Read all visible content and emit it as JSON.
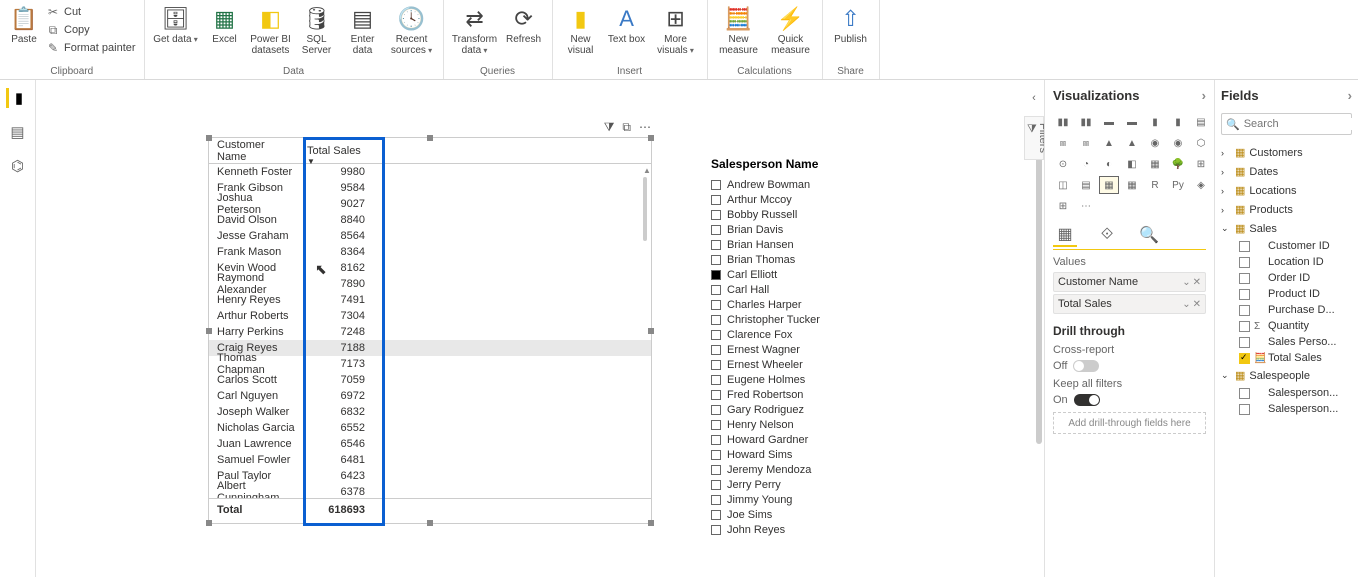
{
  "ribbon": {
    "paste": "Paste",
    "cut": "Cut",
    "copy": "Copy",
    "format_painter": "Format painter",
    "clipboard": "Clipboard",
    "get_data": "Get data",
    "excel": "Excel",
    "pbi_ds": "Power BI datasets",
    "sql": "SQL Server",
    "enter": "Enter data",
    "recent": "Recent sources",
    "data_group": "Data",
    "transform": "Transform data",
    "refresh": "Refresh",
    "queries": "Queries",
    "new_visual": "New visual",
    "text_box": "Text box",
    "more_visuals": "More visuals",
    "insert": "Insert",
    "new_measure": "New measure",
    "quick_measure": "Quick measure",
    "calculations": "Calculations",
    "publish": "Publish",
    "share": "Share"
  },
  "filters_label": "Filters",
  "chart_data": {
    "type": "table",
    "columns": [
      "Customer Name",
      "Total Sales"
    ],
    "rows": [
      [
        "Kenneth Foster",
        9980
      ],
      [
        "Frank Gibson",
        9584
      ],
      [
        "Joshua Peterson",
        9027
      ],
      [
        "David Olson",
        8840
      ],
      [
        "Jesse Graham",
        8564
      ],
      [
        "Frank Mason",
        8364
      ],
      [
        "Kevin Wood",
        8162
      ],
      [
        "Raymond Alexander",
        7890
      ],
      [
        "Henry Reyes",
        7491
      ],
      [
        "Arthur Roberts",
        7304
      ],
      [
        "Harry Perkins",
        7248
      ],
      [
        "Craig Reyes",
        7188
      ],
      [
        "Thomas Chapman",
        7173
      ],
      [
        "Carlos Scott",
        7059
      ],
      [
        "Carl Nguyen",
        6972
      ],
      [
        "Joseph Walker",
        6832
      ],
      [
        "Nicholas Garcia",
        6552
      ],
      [
        "Juan Lawrence",
        6546
      ],
      [
        "Samuel Fowler",
        6481
      ],
      [
        "Paul Taylor",
        6423
      ],
      [
        "Albert Cunningham",
        6378
      ]
    ],
    "total_label": "Total",
    "total_value": 618693,
    "highlighted_row_index": 11
  },
  "slicer": {
    "title": "Salesperson Name",
    "items": [
      {
        "name": "Andrew Bowman",
        "checked": false
      },
      {
        "name": "Arthur Mccoy",
        "checked": false
      },
      {
        "name": "Bobby Russell",
        "checked": false
      },
      {
        "name": "Brian Davis",
        "checked": false
      },
      {
        "name": "Brian Hansen",
        "checked": false
      },
      {
        "name": "Brian Thomas",
        "checked": false
      },
      {
        "name": "Carl Elliott",
        "checked": true
      },
      {
        "name": "Carl Hall",
        "checked": false
      },
      {
        "name": "Charles Harper",
        "checked": false
      },
      {
        "name": "Christopher Tucker",
        "checked": false
      },
      {
        "name": "Clarence Fox",
        "checked": false
      },
      {
        "name": "Ernest Wagner",
        "checked": false
      },
      {
        "name": "Ernest Wheeler",
        "checked": false
      },
      {
        "name": "Eugene Holmes",
        "checked": false
      },
      {
        "name": "Fred Robertson",
        "checked": false
      },
      {
        "name": "Gary Rodriguez",
        "checked": false
      },
      {
        "name": "Henry Nelson",
        "checked": false
      },
      {
        "name": "Howard Gardner",
        "checked": false
      },
      {
        "name": "Howard Sims",
        "checked": false
      },
      {
        "name": "Jeremy Mendoza",
        "checked": false
      },
      {
        "name": "Jerry Perry",
        "checked": false
      },
      {
        "name": "Jimmy Young",
        "checked": false
      },
      {
        "name": "Joe Sims",
        "checked": false
      },
      {
        "name": "John Reyes",
        "checked": false
      }
    ]
  },
  "viz_pane": {
    "title": "Visualizations",
    "values_label": "Values",
    "wells": [
      "Customer Name",
      "Total Sales"
    ],
    "drill_header": "Drill through",
    "cross_report": "Cross-report",
    "off": "Off",
    "keep_filters": "Keep all filters",
    "on": "On",
    "drill_drop": "Add drill-through fields here"
  },
  "fields_pane": {
    "title": "Fields",
    "search_placeholder": "Search",
    "tables": [
      {
        "name": "Customers",
        "expanded": false
      },
      {
        "name": "Dates",
        "expanded": false
      },
      {
        "name": "Locations",
        "expanded": false
      },
      {
        "name": "Products",
        "expanded": false
      },
      {
        "name": "Sales",
        "expanded": true,
        "fields": [
          {
            "name": "Customer ID",
            "checked": false,
            "sigma": false
          },
          {
            "name": "Location ID",
            "checked": false,
            "sigma": false
          },
          {
            "name": "Order ID",
            "checked": false,
            "sigma": false
          },
          {
            "name": "Product ID",
            "checked": false,
            "sigma": false
          },
          {
            "name": "Purchase D...",
            "checked": false,
            "sigma": false
          },
          {
            "name": "Quantity",
            "checked": false,
            "sigma": true
          },
          {
            "name": "Sales Perso...",
            "checked": false,
            "sigma": false
          },
          {
            "name": "Total Sales",
            "checked": true,
            "sigma": false,
            "measure": true
          }
        ]
      },
      {
        "name": "Salespeople",
        "expanded": true,
        "fields": [
          {
            "name": "Salesperson...",
            "checked": false,
            "sigma": false
          },
          {
            "name": "Salesperson...",
            "checked": false,
            "sigma": false
          }
        ]
      }
    ]
  }
}
